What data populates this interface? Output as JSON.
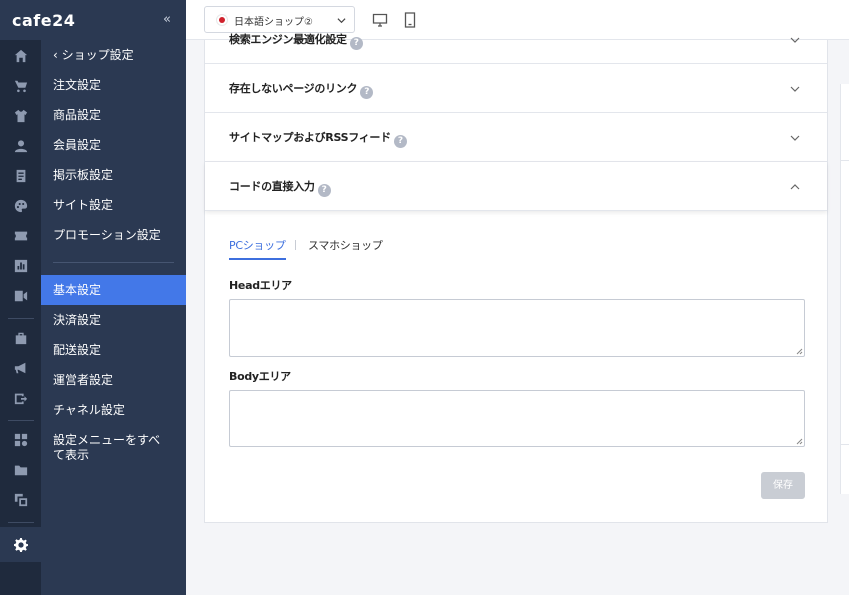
{
  "brand": {
    "logo_text": "cafe24",
    "collapse_label": "«"
  },
  "rail": {
    "icons": [
      "home-icon",
      "cart-icon",
      "shirt-icon",
      "user-icon",
      "board-icon",
      "palette-icon",
      "ticket-icon",
      "chart-icon",
      "video-icon",
      "store-icon",
      "megaphone-icon",
      "export-icon",
      "apps-icon",
      "folder-icon",
      "copy-icon",
      "gear-icon"
    ],
    "active": "gear-icon"
  },
  "menu": {
    "back_label": "ショップ設定",
    "items_top": [
      "注文設定",
      "商品設定",
      "会員設定",
      "掲示板設定",
      "サイト設定",
      "プロモーション設定"
    ],
    "items_bottom": [
      "基本設定",
      "決済設定",
      "配送設定",
      "運営者設定",
      "チャネル設定",
      "設定メニューをすべて表示"
    ],
    "active": "基本設定"
  },
  "topbar": {
    "shop_select_value": "日本語ショップ②",
    "desktop_icon": "monitor-icon",
    "mobile_icon": "tablet-icon"
  },
  "accordion": {
    "rows": [
      {
        "title": "検索エンジン最適化設定",
        "state": "collapsed"
      },
      {
        "title": "存在しないページのリンク",
        "state": "collapsed"
      },
      {
        "title": "サイトマップおよびRSSフィード",
        "state": "collapsed"
      },
      {
        "title": "コードの直接入力",
        "state": "expanded"
      }
    ],
    "help_glyph": "?"
  },
  "code_input": {
    "tabs": [
      "PCショップ",
      "スマホショップ"
    ],
    "active_tab": "PCショップ",
    "head_label": "Headエリア",
    "head_value": "",
    "body_label": "Bodyエリア",
    "body_value": "",
    "save_label": "保存"
  },
  "colors": {
    "sidebar": "#2b3952",
    "rail": "#1f2a3d",
    "accent": "#4378e8",
    "tab_active": "#3d6fde",
    "save_disabled": "#c9cdd4"
  }
}
